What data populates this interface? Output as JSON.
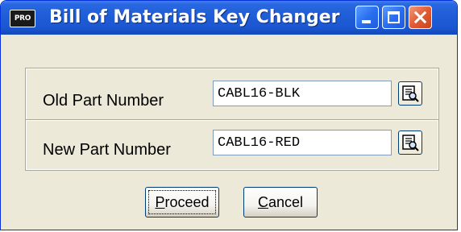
{
  "window": {
    "title": "Bill of Materials Key Changer",
    "icon_label": "PRO",
    "controls": [
      "minimize-icon",
      "maximize-icon",
      "close-icon"
    ]
  },
  "fields": {
    "old_part": {
      "label": "Old Part Number",
      "value": "CABL16-BLK",
      "lookup_icon": "lookup-icon"
    },
    "new_part": {
      "label": "New Part Number",
      "value": "CABL16-RED",
      "lookup_icon": "lookup-icon"
    }
  },
  "buttons": {
    "proceed": {
      "hotkey": "P",
      "rest": "roceed"
    },
    "cancel": {
      "hotkey": "C",
      "rest": "ancel"
    }
  },
  "colors": {
    "titlebar": "#1f5ed8",
    "dialog_bg": "#ece9d8",
    "close_button": "#e35a31"
  }
}
